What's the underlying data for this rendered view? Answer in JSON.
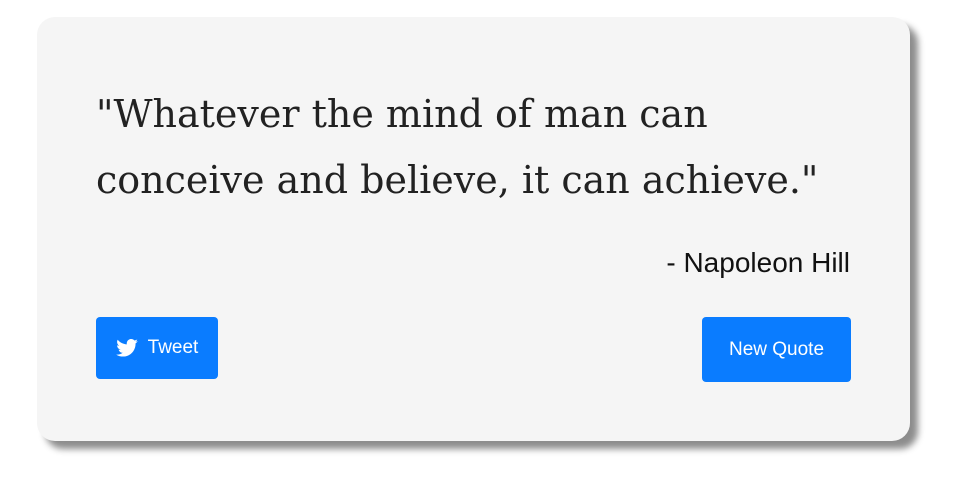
{
  "quote": {
    "text": "\"Whatever the mind of man can conceive and believe, it can achieve.\"",
    "author": "- Napoleon Hill"
  },
  "buttons": {
    "tweet_label": "Tweet",
    "tweet_icon": "twitter-bird-icon",
    "new_quote_label": "New Quote"
  },
  "colors": {
    "accent": "#0a7cff",
    "card_bg": "#f5f5f5",
    "text": "#222222"
  }
}
